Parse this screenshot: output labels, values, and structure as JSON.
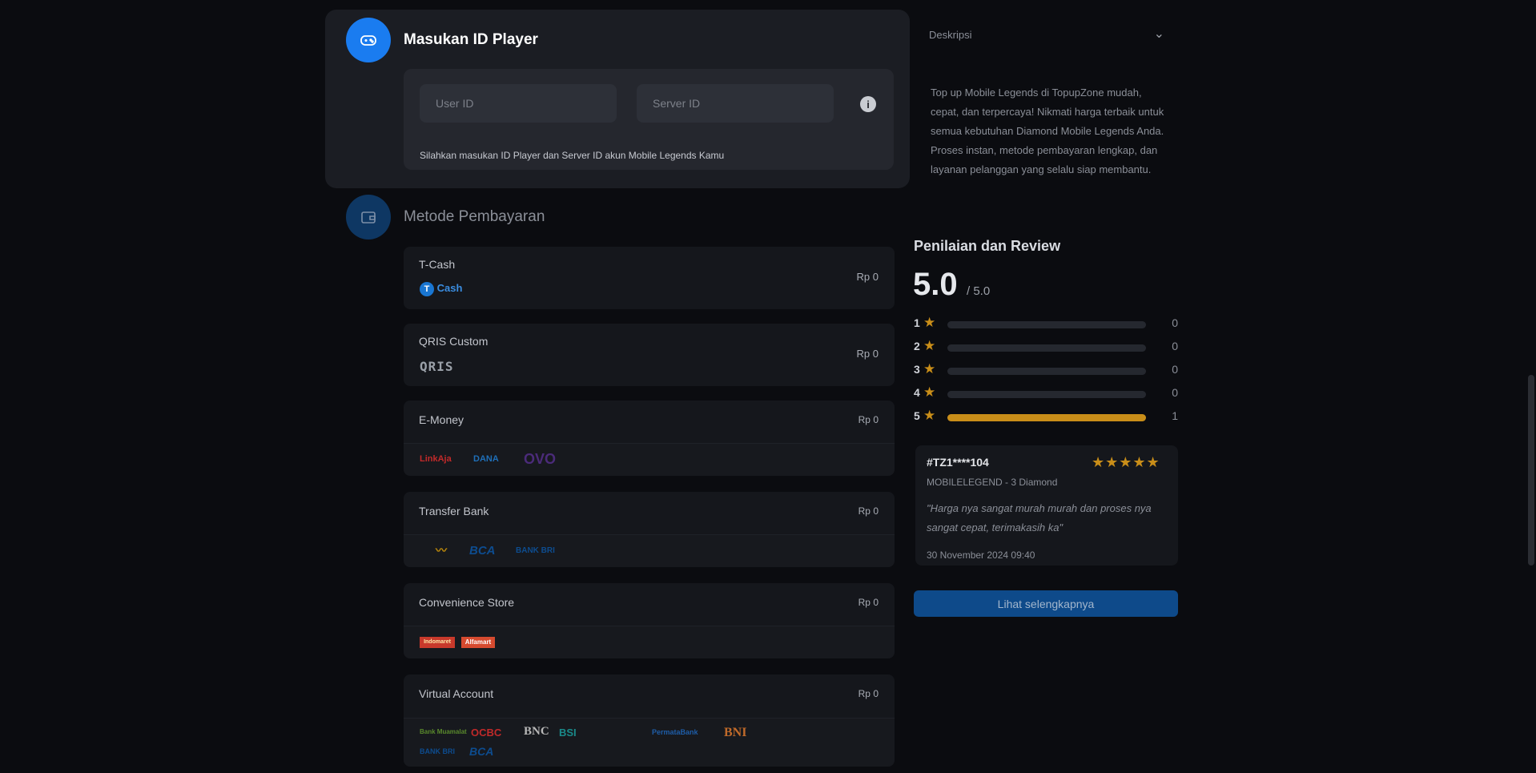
{
  "player": {
    "title": "Masukan ID Player",
    "user_id_placeholder": "User ID",
    "server_id_placeholder": "Server ID",
    "hint": "Silahkan masukan ID Player dan Server ID akun Mobile Legends Kamu"
  },
  "payment": {
    "title": "Metode Pembayaran",
    "methods": [
      {
        "name": "T-Cash",
        "price": "Rp 0",
        "logo": "Cash"
      },
      {
        "name": "QRIS Custom",
        "price": "Rp 0",
        "logo": "QRIS"
      },
      {
        "name": "E-Money",
        "price": "Rp 0",
        "logos": [
          "LinkAja",
          "DANA",
          "OVO"
        ]
      },
      {
        "name": "Transfer Bank",
        "price": "Rp 0",
        "logos": [
          "BCA",
          "BANK BRI"
        ]
      },
      {
        "name": "Convenience Store",
        "price": "Rp 0",
        "logos": [
          "Indomaret",
          "Alfamart"
        ]
      },
      {
        "name": "Virtual Account",
        "price": "Rp 0",
        "logos": [
          "Bank Muamalat",
          "OCBC",
          "BNC",
          "BSI",
          "PermataBank",
          "BNI",
          "BANK BRI",
          "BCA"
        ]
      }
    ]
  },
  "description": {
    "label": "Deskripsi",
    "text": "Top up Mobile Legends di TopupZone mudah, cepat, dan terpercaya! Nikmati harga terbaik untuk semua kebutuhan Diamond Mobile Legends Anda. Proses instan, metode pembayaran lengkap, dan layanan pelanggan yang selalu siap membantu."
  },
  "rating": {
    "title": "Penilaian dan Review",
    "score": "5.0",
    "max": "/ 5.0",
    "rows": [
      {
        "star": "1",
        "count": "0",
        "fraction": 0
      },
      {
        "star": "2",
        "count": "0",
        "fraction": 0
      },
      {
        "star": "3",
        "count": "0",
        "fraction": 0
      },
      {
        "star": "4",
        "count": "0",
        "fraction": 0
      },
      {
        "star": "5",
        "count": "1",
        "fraction": 1
      }
    ]
  },
  "review": {
    "user": "#TZ1****104",
    "stars": 5,
    "product": "MOBILELEGEND - 3 Diamond",
    "text": "\"Harga nya sangat murah murah dan proses nya sangat cepat, terimakasih ka\"",
    "date": "30 November 2024 09:40"
  },
  "more_button": "Lihat selengkapnya",
  "colors": {
    "accent": "#1a7cf0",
    "star": "#c98e19",
    "panel": "#1b1d23"
  }
}
